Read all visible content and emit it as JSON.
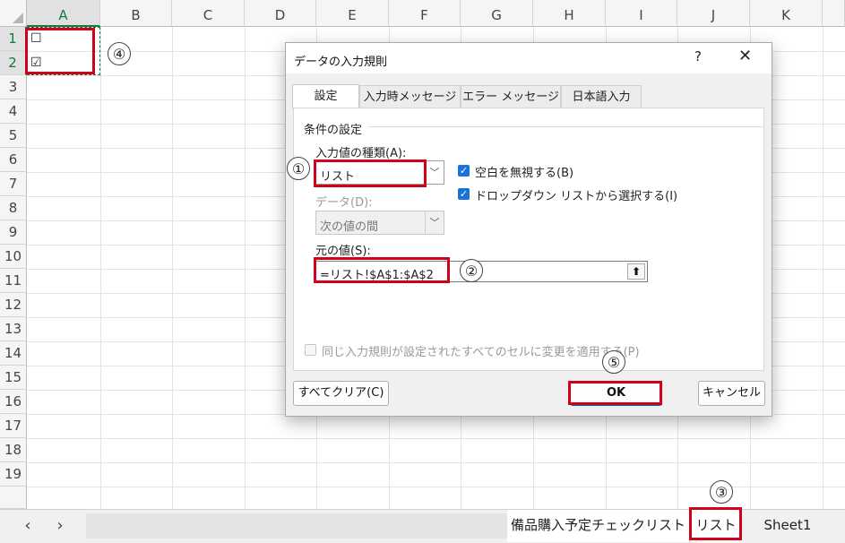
{
  "sheet": {
    "columns": [
      "A",
      "B",
      "C",
      "D",
      "E",
      "F",
      "G",
      "H",
      "I",
      "J",
      "K"
    ],
    "rows": [
      "1",
      "2",
      "3",
      "4",
      "5",
      "6",
      "7",
      "8",
      "9",
      "10",
      "11",
      "12",
      "13",
      "14",
      "15",
      "16",
      "17",
      "18",
      "19"
    ],
    "cells": {
      "A1": "☐",
      "A2": "☑"
    }
  },
  "annotations": {
    "n1": "①",
    "n2": "②",
    "n3": "③",
    "n4": "④",
    "n5": "⑤"
  },
  "tabs": {
    "nav_prev": "‹",
    "nav_next": "›",
    "sheets": [
      "備品購入予定チェックリスト",
      "リスト",
      "Sheet1"
    ]
  },
  "dialog": {
    "title": "データの入力規則",
    "help": "?",
    "close": "✕",
    "tabs": [
      "設定",
      "入力時メッセージ",
      "エラー メッセージ",
      "日本語入力"
    ],
    "group_label": "条件の設定",
    "allow_label": "入力値の種類(A):",
    "allow_value": "リスト",
    "data_label": "データ(D):",
    "data_value": "次の値の間",
    "ignore_blank": "空白を無視する(B)",
    "in_cell_dropdown": "ドロップダウン リストから選択する(I)",
    "source_label": "元の値(S):",
    "source_value": "=リスト!$A$1:$A$2",
    "apply_all": "同じ入力規則が設定されたすべてのセルに変更を適用する(P)",
    "clear_button": "すべてクリア(C)",
    "ok_button": "OK",
    "cancel_button": "キャンセル"
  },
  "colors": {
    "accent": "#107c41",
    "highlight": "#d0021b",
    "checkbox": "#1a73d6"
  }
}
